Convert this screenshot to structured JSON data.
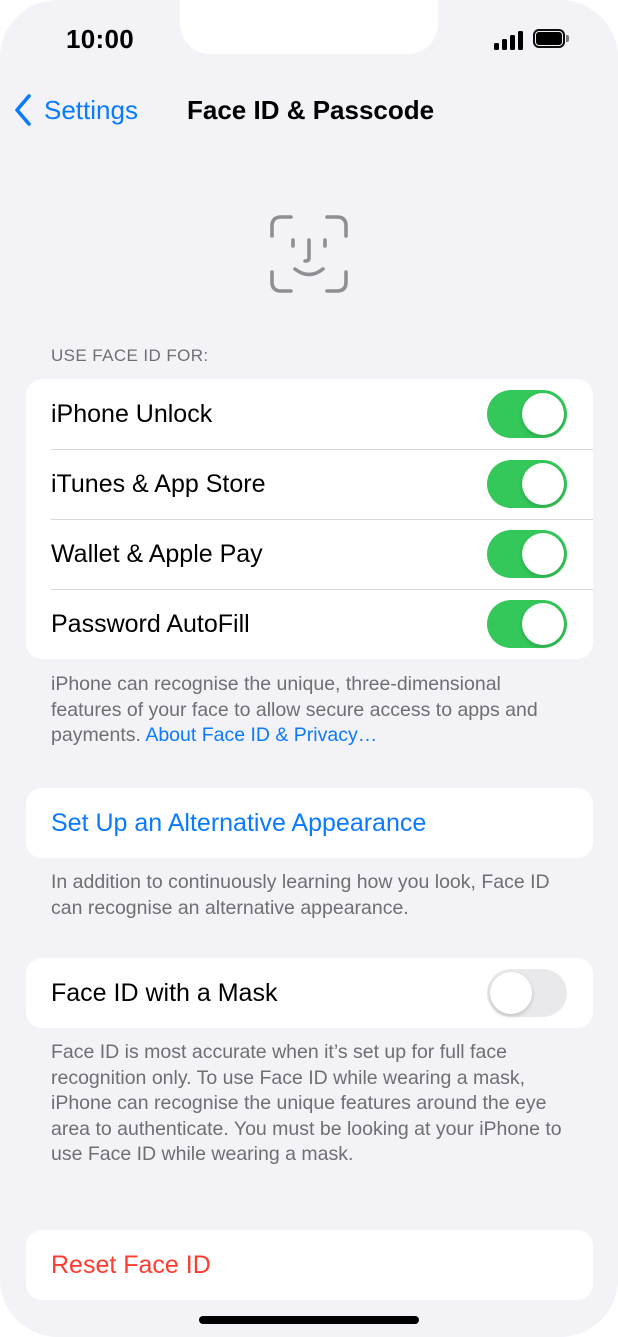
{
  "status_bar": {
    "time": "10:00"
  },
  "nav": {
    "back_label": "Settings",
    "title": "Face ID & Passcode"
  },
  "use_face_id": {
    "header": "USE FACE ID FOR:",
    "rows": [
      {
        "label": "iPhone Unlock",
        "enabled": true
      },
      {
        "label": "iTunes & App Store",
        "enabled": true
      },
      {
        "label": "Wallet & Apple Pay",
        "enabled": true
      },
      {
        "label": "Password AutoFill",
        "enabled": true
      }
    ],
    "footnote": "iPhone can recognise the unique, three-dimensional features of your face to allow secure access to apps and payments. ",
    "footnote_link": "About Face ID & Privacy…"
  },
  "alternative": {
    "label": "Set Up an Alternative Appearance",
    "footnote": "In addition to continuously learning how you look, Face ID can recognise an alternative appearance."
  },
  "mask": {
    "label": "Face ID with a Mask",
    "enabled": false,
    "footnote": "Face ID is most accurate when it’s set up for full face recognition only. To use Face ID while wearing a mask, iPhone can recognise the unique features around the eye area to authenticate. You must be looking at your iPhone to use Face ID while wearing a mask."
  },
  "reset": {
    "label": "Reset Face ID"
  },
  "colors": {
    "accent": "#0a7aff",
    "toggle_on": "#34c759",
    "destructive": "#ff3b30",
    "background": "#f2f2f7"
  },
  "icons": [
    "chevron-left-icon",
    "face-id-icon",
    "cellular-signal-icon",
    "battery-icon"
  ]
}
